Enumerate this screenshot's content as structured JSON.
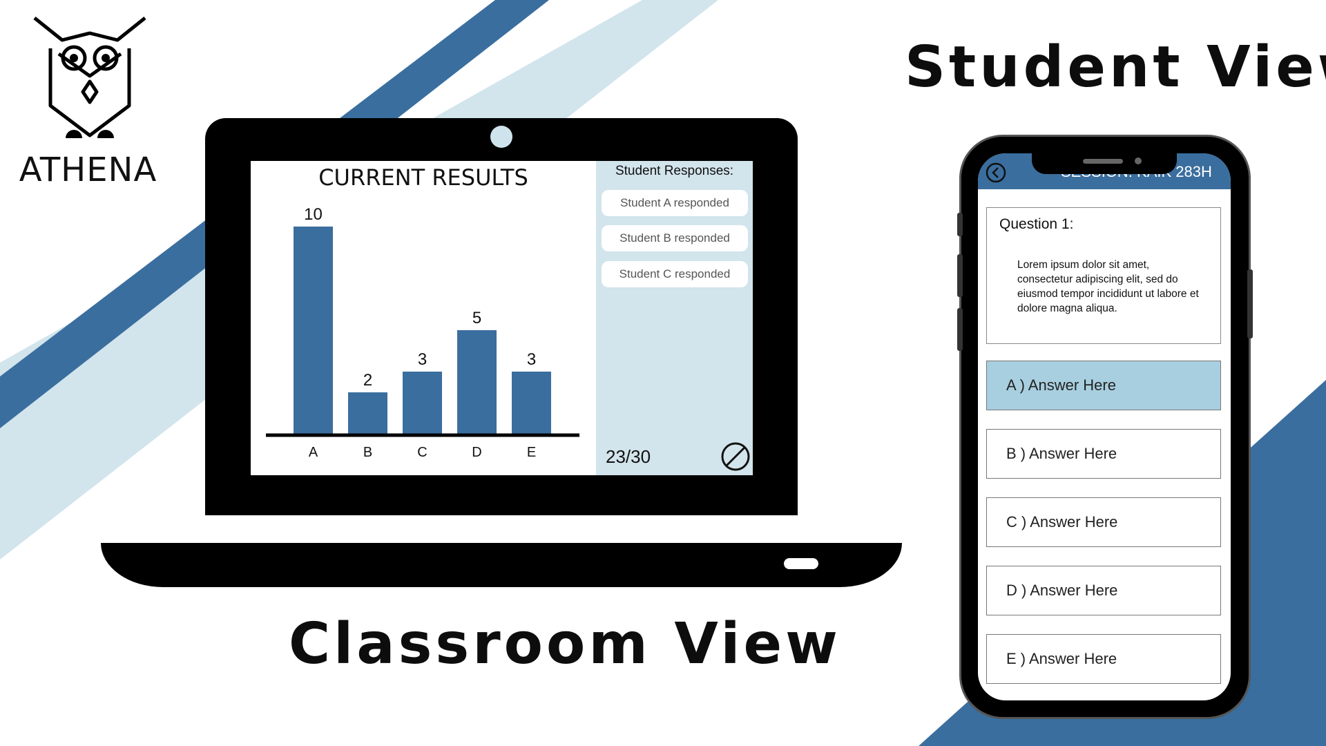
{
  "brand": {
    "name": "ATHENA"
  },
  "headings": {
    "student_view": "Student View",
    "classroom_view": "Classroom View"
  },
  "colors": {
    "accent_dark": "#3a6e9e",
    "accent_light": "#d2e4ec",
    "selected_answer": "#a8cfe0",
    "bar": "#3a6e9e"
  },
  "classroom": {
    "results_title": "CURRENT RESULTS",
    "responses_title": "Student Responses:",
    "responses": [
      "Student A responded",
      "Student B responded",
      "Student C responded"
    ],
    "response_count": "23/30",
    "stop_icon": "stop-icon"
  },
  "chart_data": {
    "type": "bar",
    "title": "CURRENT RESULTS",
    "categories": [
      "A",
      "B",
      "C",
      "D",
      "E"
    ],
    "values": [
      10,
      2,
      3,
      5,
      3
    ],
    "ylim": [
      0,
      10
    ],
    "grid": false
  },
  "student": {
    "session_label": "SESSION: KAIK 283H",
    "question_label": "Question 1:",
    "question_text": "Lorem ipsum dolor sit amet, consectetur adipiscing elit, sed do eiusmod tempor incididunt ut labore et dolore magna aliqua.",
    "answers": [
      {
        "label": "A ) Answer Here",
        "selected": true
      },
      {
        "label": "B ) Answer Here",
        "selected": false
      },
      {
        "label": "C ) Answer Here",
        "selected": false
      },
      {
        "label": "D ) Answer Here",
        "selected": false
      },
      {
        "label": "E ) Answer Here",
        "selected": false
      }
    ]
  }
}
